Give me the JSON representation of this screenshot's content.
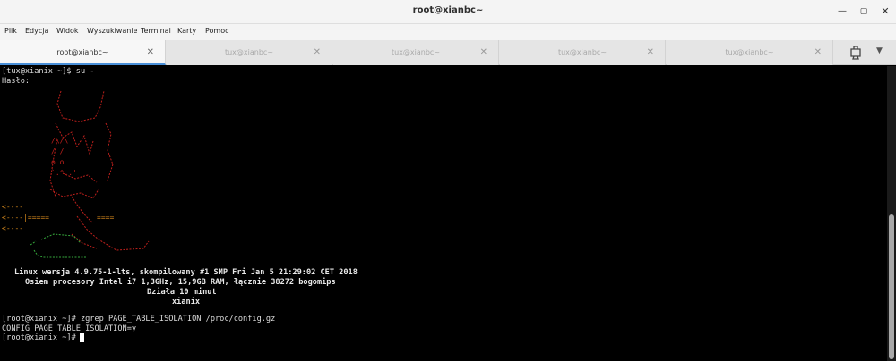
{
  "window": {
    "title": "root@xianbc~"
  },
  "menu": [
    "Plik",
    "Edycja",
    "Widok",
    "Wyszukiwanie",
    "Terminal",
    "Karty",
    "Pomoc"
  ],
  "tabs": [
    {
      "label": "root@xianbc~",
      "close": "✕"
    },
    {
      "label": "tux@xianbc~",
      "close": "✕"
    },
    {
      "label": "tux@xianbc~",
      "close": "✕"
    },
    {
      "label": "tux@xianbc~",
      "close": "✕"
    },
    {
      "label": "tux@xianbc~",
      "close": "✕"
    }
  ],
  "terminal": {
    "lines": [
      "[tux@xianix ~]$ su -",
      "Hasło:"
    ],
    "sysinfo": [
      "Linux wersja 4.9.75-1-lts, skompilowany #1 SMP Fri Jan 5 21:29:02 CET 2018",
      "Osiem procesory Intel i7 1,3GHz, 15,9GB RAM, łącznie 38272 bogomips",
      "Działa 10 minut",
      "xianix"
    ],
    "commands": [
      "[root@xianix ~]# zgrep PAGE_TABLE_ISOLATION /proc/config.gz",
      "CONFIG_PAGE_TABLE_ISOLATION=y",
      "[root@xianix ~]# "
    ]
  },
  "colors": {
    "art_red": "#c0201c",
    "art_orange": "#d98a1c",
    "art_green": "#35a63b",
    "accent": "#4a90d9"
  }
}
